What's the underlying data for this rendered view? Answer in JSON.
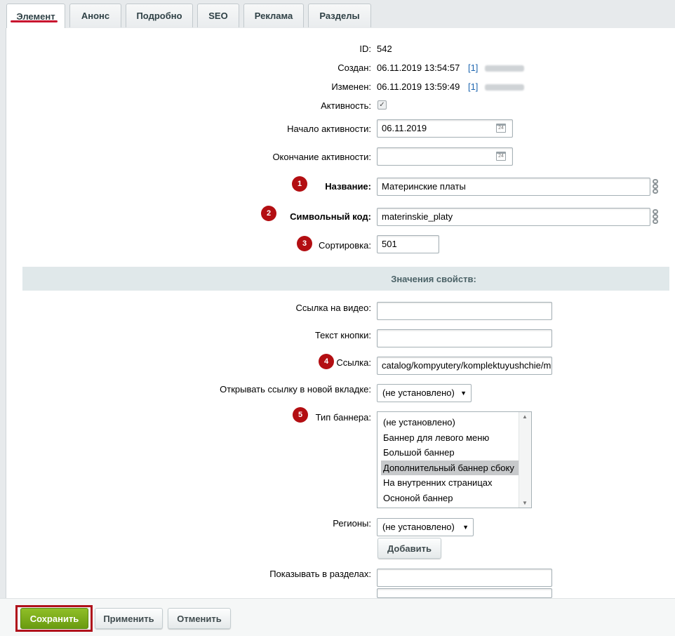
{
  "tabs": [
    {
      "label": "Элемент",
      "active": true
    },
    {
      "label": "Анонс"
    },
    {
      "label": "Подробно"
    },
    {
      "label": "SEO"
    },
    {
      "label": "Реклама"
    },
    {
      "label": "Разделы"
    }
  ],
  "fields": {
    "id": {
      "label": "ID:",
      "value": "542"
    },
    "created": {
      "label": "Создан:",
      "value": "06.11.2019 13:54:57",
      "user_link": "[1]"
    },
    "modified": {
      "label": "Изменен:",
      "value": "06.11.2019 13:59:49",
      "user_link": "[1]"
    },
    "active": {
      "label": "Активность:",
      "checked": true
    },
    "active_from": {
      "label": "Начало активности:",
      "value": "06.11.2019"
    },
    "active_to": {
      "label": "Окончание активности:",
      "value": ""
    },
    "name": {
      "label": "Название:",
      "value": "Материнские платы",
      "badge": "1"
    },
    "code": {
      "label": "Символьный код:",
      "value": "materinskie_platy",
      "badge": "2"
    },
    "sort": {
      "label": "Сортировка:",
      "value": "501",
      "badge": "3"
    }
  },
  "properties": {
    "heading": "Значения свойств:",
    "video_link": {
      "label": "Ссылка на видео:",
      "value": ""
    },
    "button_text": {
      "label": "Текст кнопки:",
      "value": ""
    },
    "link": {
      "label": "Ссылка:",
      "value": "catalog/kompyutery/komplektuyushchie/m",
      "badge": "4"
    },
    "open_new_tab": {
      "label": "Открывать ссылку в новой вкладке:",
      "selected": "(не установлено)"
    },
    "banner_type": {
      "label": "Тип баннера:",
      "badge": "5",
      "options": [
        "(не установлено)",
        "Баннер для левого меню",
        "Большой баннер",
        "Дополнительный баннер сбоку",
        "На внутренних страницах",
        "Осноной баннер"
      ],
      "selected_index": 3
    },
    "regions": {
      "label": "Регионы:",
      "selected": "(не установлено)",
      "add_label": "Добавить"
    },
    "show_in_sections": {
      "label": "Показывать в разделах:",
      "value": ""
    }
  },
  "footer": {
    "save": "Сохранить",
    "apply": "Применить",
    "cancel": "Отменить"
  },
  "colors": {
    "badge": "#b30e12",
    "save_button": "#7aab18",
    "active_tab_underline": "#c8102e",
    "link": "#2067b0"
  }
}
